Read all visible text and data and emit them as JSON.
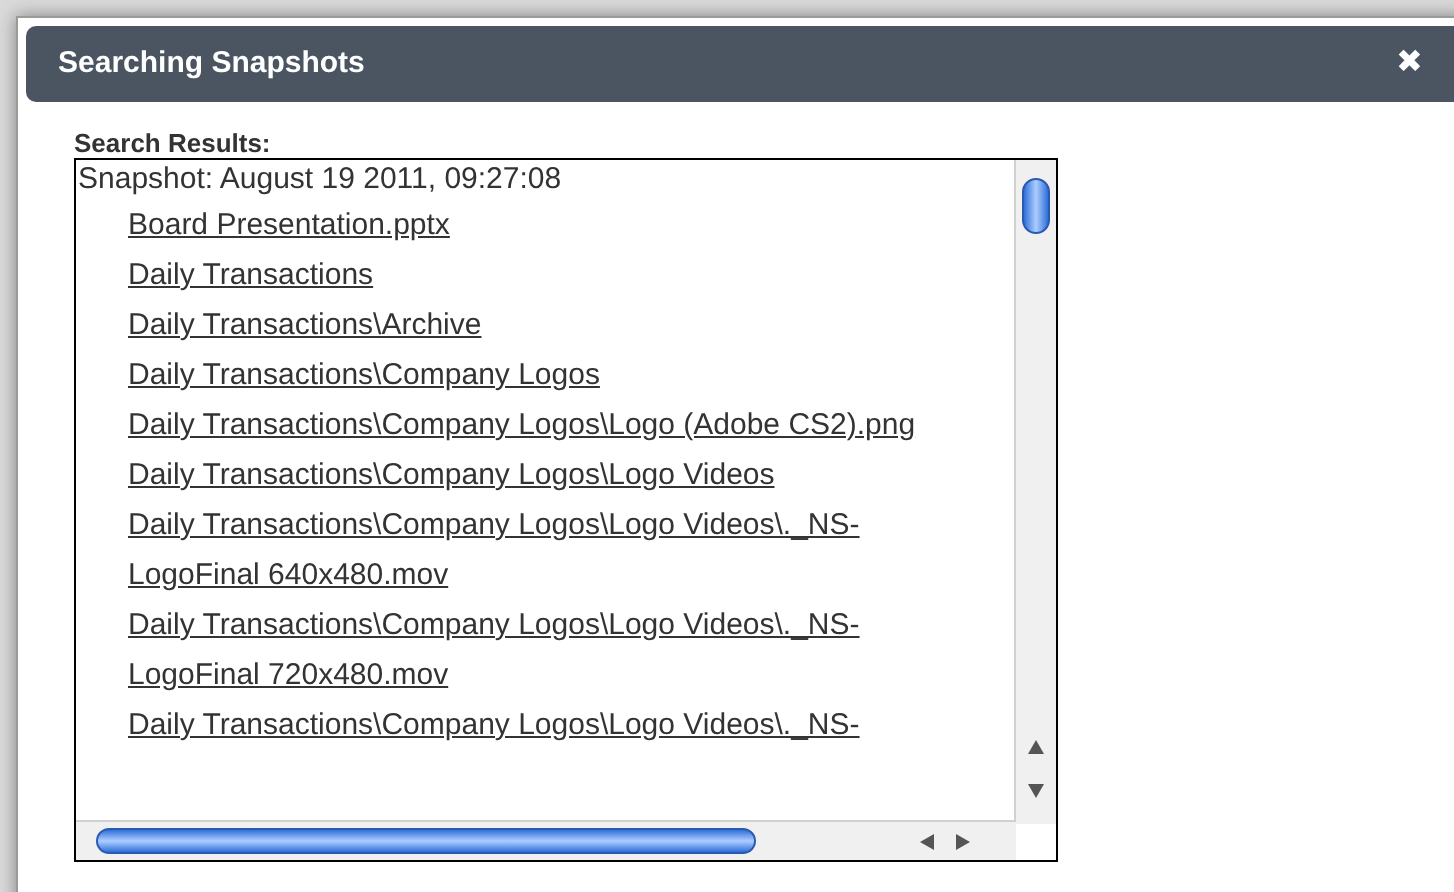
{
  "dialog": {
    "title": "Searching Snapshots",
    "close": "✖"
  },
  "results": {
    "label": "Search Results:",
    "snapshot": "Snapshot: August 19 2011, 09:27:08",
    "items": [
      "Board Presentation.pptx",
      "Daily Transactions",
      "Daily Transactions\\Archive",
      "Daily Transactions\\Company Logos",
      "Daily Transactions\\Company Logos\\Logo (Adobe CS2).png",
      "Daily Transactions\\Company Logos\\Logo Videos",
      "Daily Transactions\\Company Logos\\Logo Videos\\._NS-LogoFinal 640x480.mov",
      "Daily Transactions\\Company Logos\\Logo Videos\\._NS-LogoFinal 720x480.mov",
      "Daily Transactions\\Company Logos\\Logo Videos\\._NS-"
    ]
  }
}
